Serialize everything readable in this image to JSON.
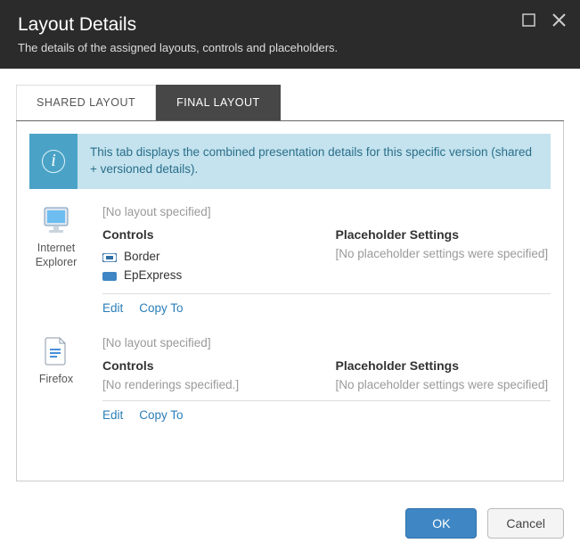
{
  "header": {
    "title": "Layout Details",
    "subtitle": "The details of the assigned layouts, controls and placeholders."
  },
  "tabs": {
    "shared": "SHARED LAYOUT",
    "final": "FINAL LAYOUT"
  },
  "info": {
    "text": "This tab displays the combined presentation details for this specific version (shared + versioned details)."
  },
  "devices": [
    {
      "name": "Internet Explorer",
      "no_layout": "[No layout specified]",
      "controls_heading": "Controls",
      "controls": [
        "Border",
        "EpExpress"
      ],
      "controls_empty": "",
      "placeholder_heading": "Placeholder Settings",
      "placeholder_empty": "[No placeholder settings were specified]",
      "edit": "Edit",
      "copyto": "Copy To"
    },
    {
      "name": "Firefox",
      "no_layout": "[No layout specified]",
      "controls_heading": "Controls",
      "controls": [],
      "controls_empty": "[No renderings specified.]",
      "placeholder_heading": "Placeholder Settings",
      "placeholder_empty": "[No placeholder settings were specified]",
      "edit": "Edit",
      "copyto": "Copy To"
    }
  ],
  "buttons": {
    "ok": "OK",
    "cancel": "Cancel"
  }
}
